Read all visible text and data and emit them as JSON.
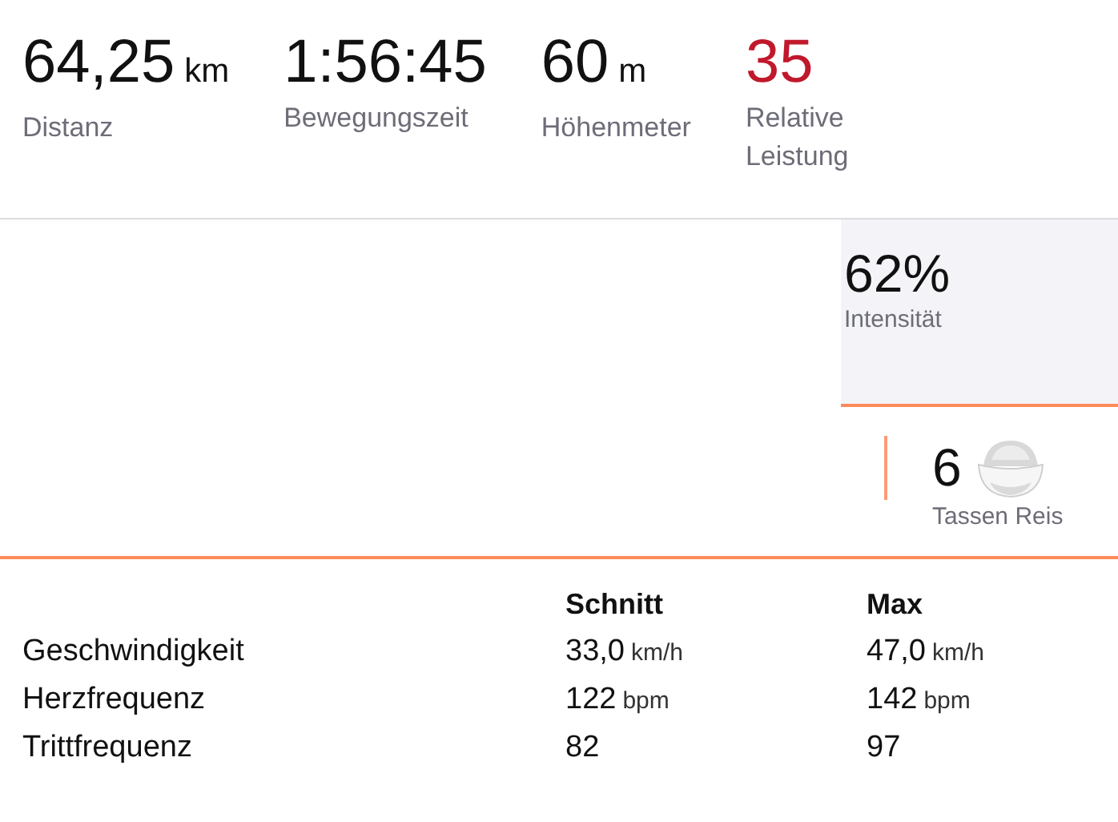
{
  "stats": [
    {
      "value": "64,25",
      "unit": "km",
      "label": "Distanz",
      "highlighted": false
    },
    {
      "value": "1:56:45",
      "label": "Bewegungszeit",
      "highlighted": false
    },
    {
      "value": "60",
      "unit": "m",
      "label": "Höhenmeter",
      "highlighted": false
    },
    {
      "value": "35",
      "label": "Relative Leistung",
      "highlighted": true
    }
  ],
  "intensity": {
    "value": "62%",
    "label": "Intensität"
  },
  "calories": {
    "value": "6",
    "label": "Tassen Reis"
  },
  "table": {
    "columns": [
      "Schnitt",
      "Max"
    ],
    "rows": [
      {
        "name": "Geschwindigkeit",
        "avg": "33,0",
        "avg_unit": "km/h",
        "max": "47,0",
        "max_unit": "km/h"
      },
      {
        "name": "Herzfrequenz",
        "avg": "122",
        "avg_unit": "bpm",
        "max": "142",
        "max_unit": "bpm"
      },
      {
        "name": "Trittfrequenz",
        "avg": "82",
        "max": "97"
      }
    ]
  }
}
